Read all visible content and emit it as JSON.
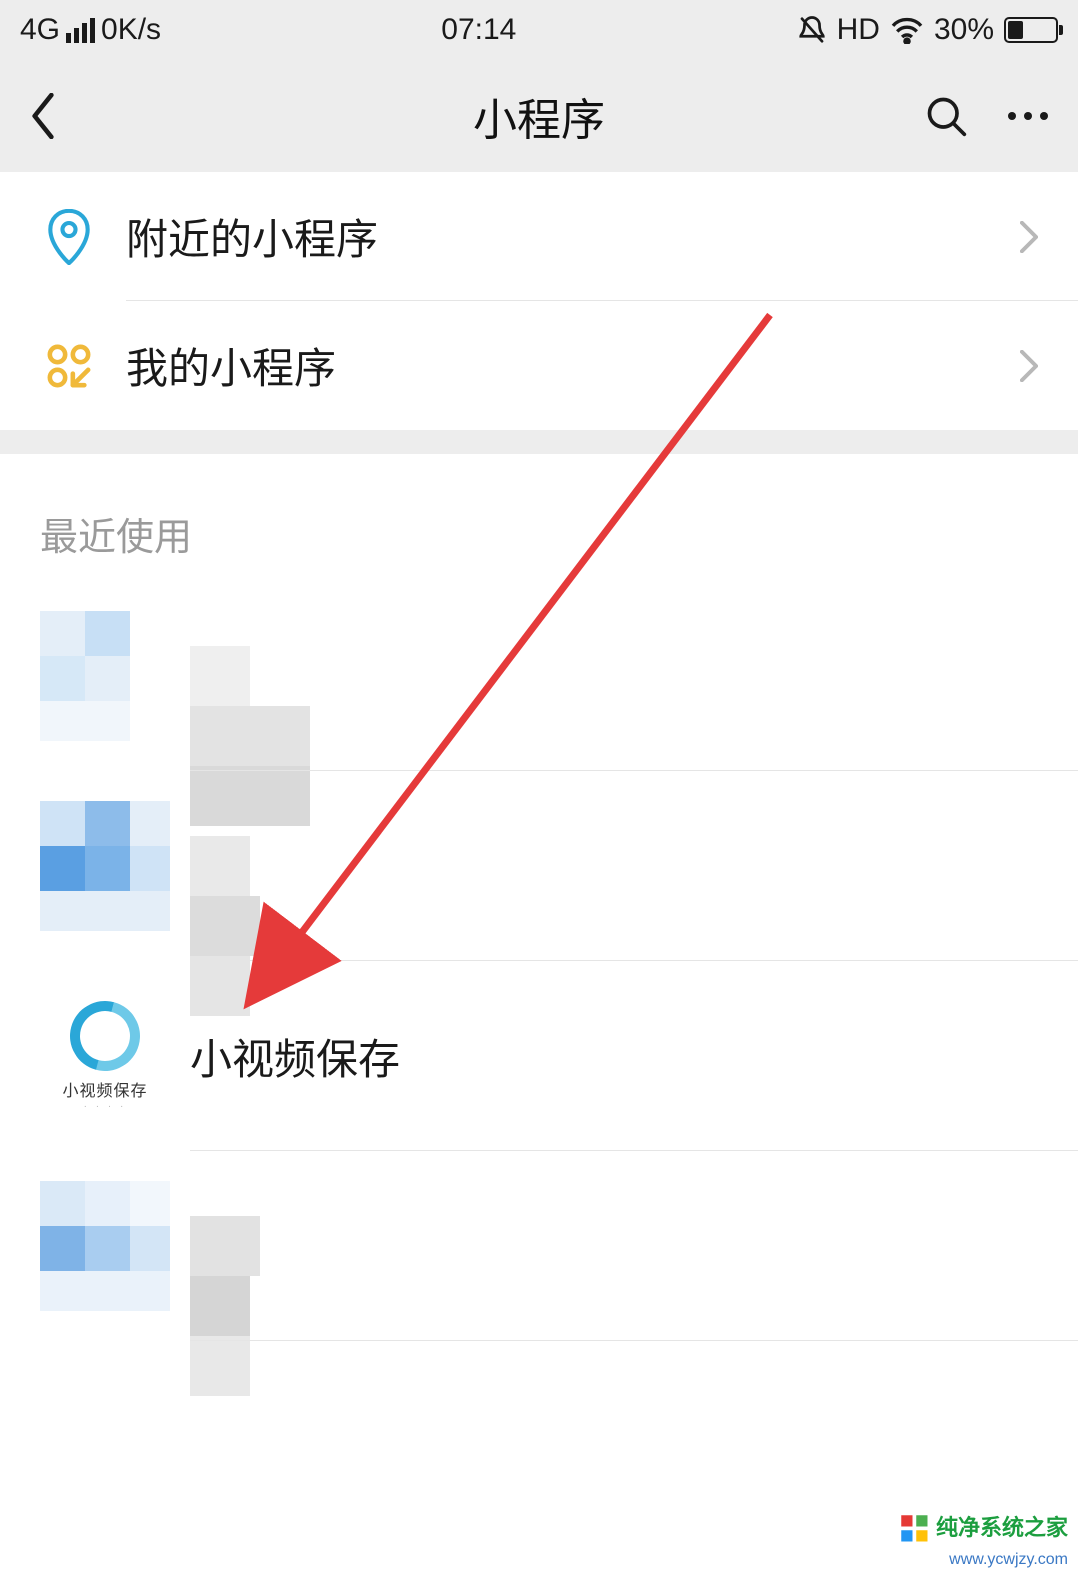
{
  "status": {
    "network": "4G",
    "speed": "0K/s",
    "time": "07:14",
    "hd": "HD",
    "battery_pct": "30%"
  },
  "nav": {
    "title": "小程序"
  },
  "menu": {
    "nearby": "附近的小程序",
    "mine": "我的小程序"
  },
  "recent": {
    "header": "最近使用",
    "items": [
      {
        "name": ""
      },
      {
        "name": ""
      },
      {
        "name": "小视频保存",
        "logo_caption": "小视频保存"
      },
      {
        "name": ""
      }
    ]
  },
  "watermark": {
    "line1": "纯净系统之家",
    "line2": "www.ycwjzy.com"
  }
}
